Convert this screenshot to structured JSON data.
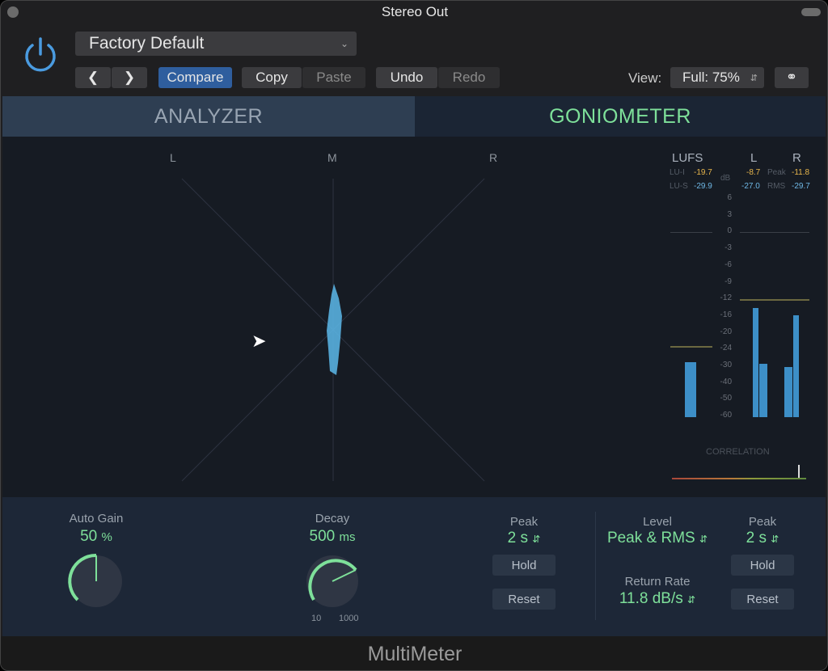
{
  "window": {
    "title": "Stereo Out",
    "footer": "MultiMeter"
  },
  "header": {
    "preset": "Factory Default",
    "compare": "Compare",
    "copy": "Copy",
    "paste": "Paste",
    "undo": "Undo",
    "redo": "Redo",
    "view_label": "View:",
    "view_value": "Full: 75%"
  },
  "tabs": [
    {
      "label": "ANALYZER",
      "active": false
    },
    {
      "label": "GONIOMETER",
      "active": true
    }
  ],
  "goniometer": {
    "labels": {
      "l": "L",
      "m": "M",
      "r": "R"
    }
  },
  "meters": {
    "lufs_header": "LUFS",
    "l_header": "L",
    "r_header": "R",
    "db": "dB",
    "lu_i_label": "LU-I",
    "lu_i": "-19.7",
    "lu_s_label": "LU-S",
    "lu_s": "-29.9",
    "peak_label": "Peak",
    "rms_label": "RMS",
    "l_peak": "-8.7",
    "r_peak": "-11.8",
    "l_rms": "-27.0",
    "r_rms": "-29.7",
    "scale": [
      "6",
      "3",
      "0",
      "-3",
      "-6",
      "-9",
      "-12",
      "-16",
      "-20",
      "-24",
      "-30",
      "-40",
      "-50",
      "-60"
    ],
    "correlation_label": "CORRELATION",
    "correlation_value": 0.85,
    "colors": {
      "peak": "#e8b64c",
      "rms": "#6fb8e6",
      "bar": "#3d8fc7",
      "accent": "#7ee09a"
    }
  },
  "controls": {
    "auto_gain_label": "Auto Gain",
    "auto_gain_value": "50",
    "auto_gain_unit": "%",
    "decay_label": "Decay",
    "decay_value": "500",
    "decay_unit": "ms",
    "decay_min": "10",
    "decay_max": "1000",
    "peak1_label": "Peak",
    "peak1_value": "2 s",
    "hold1": "Hold",
    "reset1": "Reset",
    "level_label": "Level",
    "level_value": "Peak & RMS",
    "return_label": "Return Rate",
    "return_value": "11.8 dB/s",
    "peak2_label": "Peak",
    "peak2_value": "2 s",
    "hold2": "Hold",
    "reset2": "Reset"
  }
}
